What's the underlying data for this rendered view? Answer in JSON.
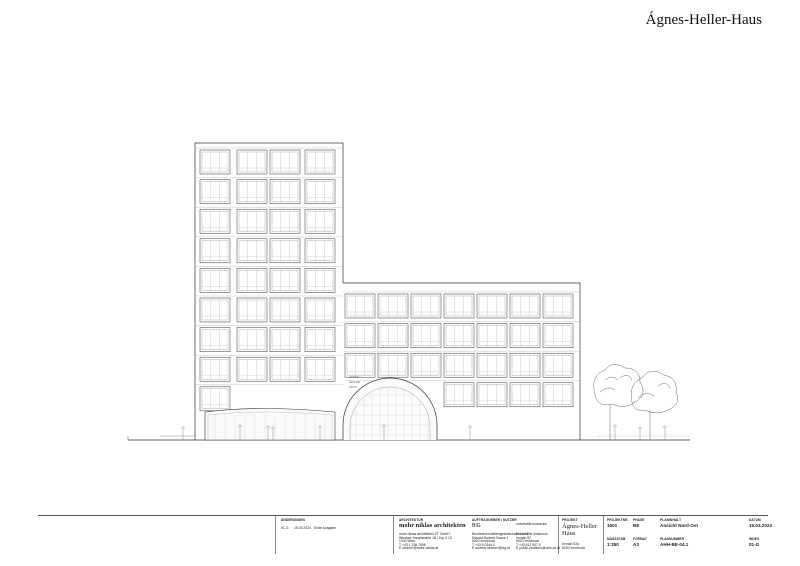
{
  "header": {
    "title": "Ágnes-Heller-Haus"
  },
  "facade": {
    "sign_lines": [
      "ÁGNES",
      "HELLER",
      "HAUS"
    ]
  },
  "titleblock": {
    "changes": {
      "label": "ÄNDERUNGEN",
      "index": "01-G",
      "date": "15.03.2024",
      "note": "Erste Ausgabe"
    },
    "architect": {
      "label": "ARCHITEKTUR",
      "name": "mohr niklas architekten",
      "lines": [
        "mohr niklas architekten ZT GmbH",
        "Wiedner Hauptstraße 18 / Top 2.13",
        "1040 Wien",
        "T +43 1 236 7698",
        "E zimmer@mohr-niklas.at"
      ]
    },
    "client": {
      "label": "AUFTRAGGEBER / NUTZER",
      "big": "BIG",
      "lines": [
        "Bundesimmobiliengesellschaft m.b.H",
        "Eduard-Bodem-Gasse 1",
        "6020 Innsbruck",
        "T +43 5 0244-0",
        "E andrea.mosner@big.at"
      ],
      "uni": "universität innsbruck",
      "uni_lines": [
        "Universität Innsbruck",
        "Innrain 52",
        "6020 Innsbruck",
        "T +43 512 507-0",
        "E public-relations@uibk.ac.at"
      ]
    },
    "project": {
      "label": "PROJEKT",
      "name": "Ágnes-Heller Haus",
      "address_lines": [
        "Innrain 52a",
        "6020 Innsbruck"
      ]
    },
    "project_no": {
      "label": "PROJEKTNR.",
      "value": "1601"
    },
    "phase": {
      "label": "PHASE",
      "value": "BE"
    },
    "content": {
      "label": "PLANINHALT",
      "value": "Ansicht Nord-Ost"
    },
    "date": {
      "label": "DATUM",
      "value": "15.03.2024"
    },
    "scale": {
      "label": "MASSSTAB",
      "value": "1:250"
    },
    "format": {
      "label": "FORMAT",
      "value": "A3"
    },
    "plan_no": {
      "label": "PLANNUMMER",
      "value": "AHH-BE-04.1"
    },
    "index": {
      "label": "INDEX",
      "value": "01-G"
    }
  }
}
